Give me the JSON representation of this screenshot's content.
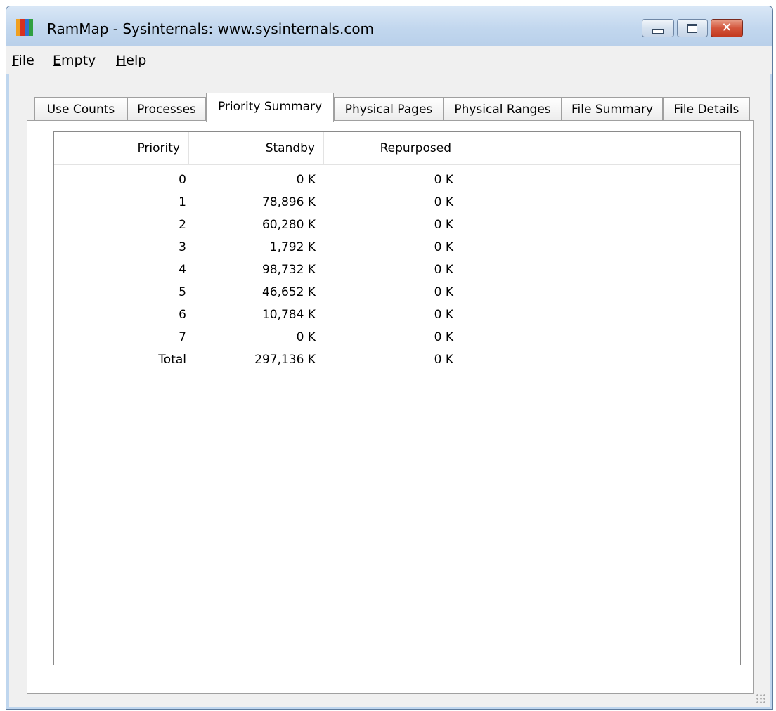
{
  "window": {
    "title": "RamMap - Sysinternals: www.sysinternals.com",
    "icon": "rammap-bars-icon",
    "icon_colors": [
      "#f0a020",
      "#d83020",
      "#3070d0",
      "#30a040"
    ]
  },
  "menu": [
    {
      "label": "File",
      "underline": "F"
    },
    {
      "label": "Empty",
      "underline": "E"
    },
    {
      "label": "Help",
      "underline": "H"
    }
  ],
  "tabs": [
    {
      "label": "Use Counts",
      "active": false
    },
    {
      "label": "Processes",
      "active": false
    },
    {
      "label": "Priority Summary",
      "active": true
    },
    {
      "label": "Physical Pages",
      "active": false
    },
    {
      "label": "Physical Ranges",
      "active": false
    },
    {
      "label": "File Summary",
      "active": false
    },
    {
      "label": "File Details",
      "active": false
    }
  ],
  "table": {
    "columns": [
      "Priority",
      "Standby",
      "Repurposed"
    ],
    "rows": [
      [
        "0",
        "0 K",
        "0 K"
      ],
      [
        "1",
        "78,896 K",
        "0 K"
      ],
      [
        "2",
        "60,280 K",
        "0 K"
      ],
      [
        "3",
        "1,792 K",
        "0 K"
      ],
      [
        "4",
        "98,732 K",
        "0 K"
      ],
      [
        "5",
        "46,652 K",
        "0 K"
      ],
      [
        "6",
        "10,784 K",
        "0 K"
      ],
      [
        "7",
        "0 K",
        "0 K"
      ],
      [
        "Total",
        "297,136 K",
        "0 K"
      ]
    ]
  }
}
